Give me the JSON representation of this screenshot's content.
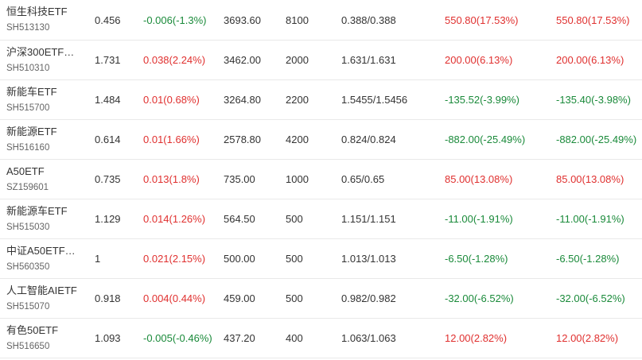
{
  "colors": {
    "up": "#e0302f",
    "down": "#1a8a3a",
    "text": "#333333",
    "subtext": "#666666"
  },
  "rows": [
    {
      "name": "恒生科技ETF",
      "code": "SH513130",
      "price": "0.456",
      "change": "-0.006(-1.3%)",
      "change_dir": "down",
      "market_value": "3693.60",
      "qty": "8100",
      "cost": "0.388/0.388",
      "pnl": "550.80(17.53%)",
      "pnl_dir": "up",
      "pnl2": "550.80(17.53%)",
      "pnl2_dir": "up"
    },
    {
      "name": "沪深300ETF…",
      "code": "SH510310",
      "price": "1.731",
      "change": "0.038(2.24%)",
      "change_dir": "up",
      "market_value": "3462.00",
      "qty": "2000",
      "cost": "1.631/1.631",
      "pnl": "200.00(6.13%)",
      "pnl_dir": "up",
      "pnl2": "200.00(6.13%)",
      "pnl2_dir": "up"
    },
    {
      "name": "新能车ETF",
      "code": "SH515700",
      "price": "1.484",
      "change": "0.01(0.68%)",
      "change_dir": "up",
      "market_value": "3264.80",
      "qty": "2200",
      "cost": "1.5455/1.5456",
      "pnl": "-135.52(-3.99%)",
      "pnl_dir": "down",
      "pnl2": "-135.40(-3.98%)",
      "pnl2_dir": "down"
    },
    {
      "name": "新能源ETF",
      "code": "SH516160",
      "price": "0.614",
      "change": "0.01(1.66%)",
      "change_dir": "up",
      "market_value": "2578.80",
      "qty": "4200",
      "cost": "0.824/0.824",
      "pnl": "-882.00(-25.49%)",
      "pnl_dir": "down",
      "pnl2": "-882.00(-25.49%)",
      "pnl2_dir": "down"
    },
    {
      "name": "A50ETF",
      "code": "SZ159601",
      "price": "0.735",
      "change": "0.013(1.8%)",
      "change_dir": "up",
      "market_value": "735.00",
      "qty": "1000",
      "cost": "0.65/0.65",
      "pnl": "85.00(13.08%)",
      "pnl_dir": "up",
      "pnl2": "85.00(13.08%)",
      "pnl2_dir": "up"
    },
    {
      "name": "新能源车ETF",
      "code": "SH515030",
      "price": "1.129",
      "change": "0.014(1.26%)",
      "change_dir": "up",
      "market_value": "564.50",
      "qty": "500",
      "cost": "1.151/1.151",
      "pnl": "-11.00(-1.91%)",
      "pnl_dir": "down",
      "pnl2": "-11.00(-1.91%)",
      "pnl2_dir": "down"
    },
    {
      "name": "中证A50ETF…",
      "code": "SH560350",
      "price": "1",
      "change": "0.021(2.15%)",
      "change_dir": "up",
      "market_value": "500.00",
      "qty": "500",
      "cost": "1.013/1.013",
      "pnl": "-6.50(-1.28%)",
      "pnl_dir": "down",
      "pnl2": "-6.50(-1.28%)",
      "pnl2_dir": "down"
    },
    {
      "name": "人工智能AIETF",
      "code": "SH515070",
      "price": "0.918",
      "change": "0.004(0.44%)",
      "change_dir": "up",
      "market_value": "459.00",
      "qty": "500",
      "cost": "0.982/0.982",
      "pnl": "-32.00(-6.52%)",
      "pnl_dir": "down",
      "pnl2": "-32.00(-6.52%)",
      "pnl2_dir": "down"
    },
    {
      "name": "有色50ETF",
      "code": "SH516650",
      "price": "1.093",
      "change": "-0.005(-0.46%)",
      "change_dir": "down",
      "market_value": "437.20",
      "qty": "400",
      "cost": "1.063/1.063",
      "pnl": "12.00(2.82%)",
      "pnl_dir": "up",
      "pnl2": "12.00(2.82%)",
      "pnl2_dir": "up"
    }
  ]
}
